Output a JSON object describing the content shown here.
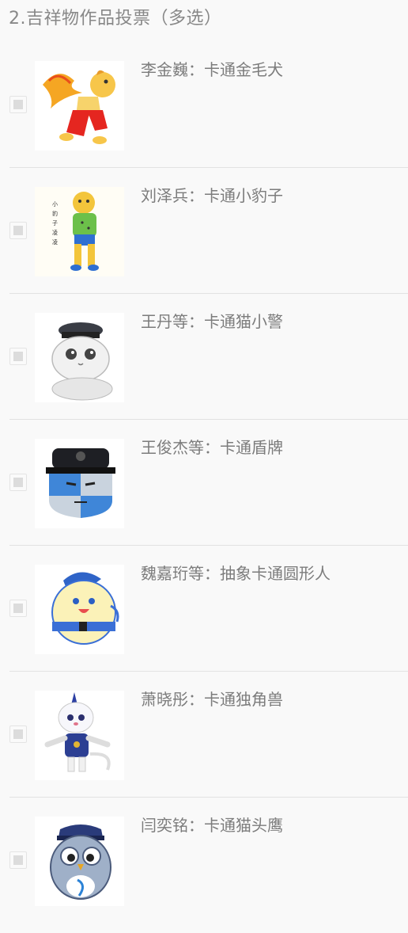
{
  "question": {
    "title": "2.吉祥物作品投票（多选）"
  },
  "options": [
    {
      "label": "李金巍：卡通金毛犬",
      "image": "cartoon-golden-dog-drawing",
      "checked": false
    },
    {
      "label": "刘泽兵：卡通小豹子",
      "image": "cartoon-little-leopard-drawing",
      "checked": false
    },
    {
      "label": "王丹等：卡通猫小警",
      "image": "cartoon-police-cat-sketch",
      "checked": false
    },
    {
      "label": "王俊杰等：卡通盾牌",
      "image": "cartoon-shield-with-police-cap",
      "checked": false
    },
    {
      "label": "魏嘉珩等：抽象卡通圆形人",
      "image": "abstract-round-cartoon-figure",
      "checked": false
    },
    {
      "label": "萧晓彤：卡通独角兽",
      "image": "cartoon-unicorn-cat",
      "checked": false
    },
    {
      "label": "闫奕铭：卡通猫头鹰",
      "image": "cartoon-police-owl",
      "checked": false
    }
  ]
}
